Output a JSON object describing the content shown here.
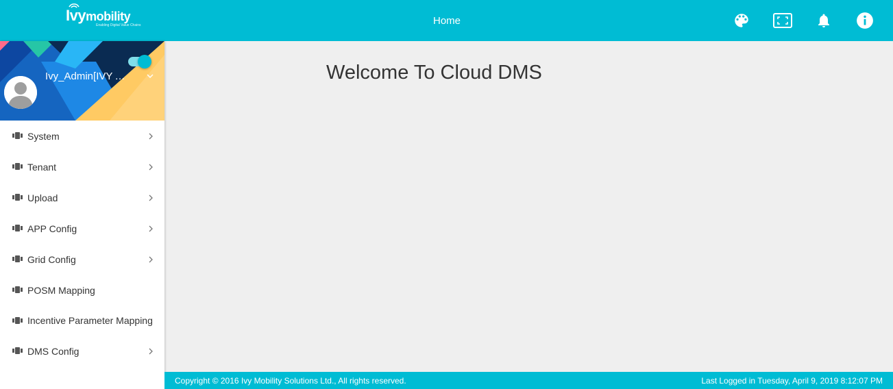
{
  "colors": {
    "primary": "#00bcd4",
    "background": "#efefef",
    "text": "#333333",
    "menu_icon": "#555555"
  },
  "brand": {
    "name_a": "Ivy",
    "name_b": "mobility",
    "tagline": "Enabling Digital Value Chains",
    "icon": "wifi-logo-icon"
  },
  "header": {
    "home_label": "Home",
    "icons": [
      "palette-icon",
      "fullscreen-icon",
      "bell-icon",
      "info-icon"
    ]
  },
  "user": {
    "name": "Ivy_Admin[IVY A...",
    "avatar_icon": "user-avatar-icon",
    "toggle_on": true
  },
  "menu": {
    "items": [
      {
        "label": "System",
        "has_children": true
      },
      {
        "label": "Tenant",
        "has_children": true
      },
      {
        "label": "Upload",
        "has_children": true
      },
      {
        "label": "APP Config",
        "has_children": true
      },
      {
        "label": "Grid Config",
        "has_children": true
      },
      {
        "label": "POSM Mapping",
        "has_children": false
      },
      {
        "label": "Incentive Parameter Mapping",
        "has_children": false
      },
      {
        "label": "DMS Config",
        "has_children": true
      }
    ]
  },
  "main": {
    "welcome": "Welcome To Cloud DMS"
  },
  "footer": {
    "copyright": "Copyright © 2016 Ivy Mobility Solutions Ltd., All rights reserved.",
    "last_logged": "Last Logged in Tuesday, April 9, 2019 8:12:07 PM"
  }
}
